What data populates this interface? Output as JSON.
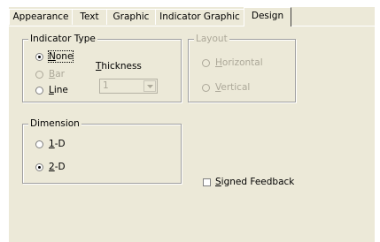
{
  "tabs": [
    {
      "label": "Appearance"
    },
    {
      "label": "Text"
    },
    {
      "label": "Graphic"
    },
    {
      "label": "Indicator Graphic"
    },
    {
      "label": "Design"
    }
  ],
  "active_tab": "Design",
  "indicator_type": {
    "title": "Indicator Type",
    "options": [
      {
        "label": "None",
        "mnemonic": "N",
        "rest": "one",
        "checked": true,
        "disabled": false
      },
      {
        "label": "Bar",
        "mnemonic": "B",
        "rest": "ar",
        "checked": false,
        "disabled": true
      },
      {
        "label": "Line",
        "mnemonic": "L",
        "rest": "ine",
        "checked": false,
        "disabled": false
      }
    ],
    "thickness": {
      "label_pre": "",
      "label_mnemonic": "T",
      "label_rest": "hickness",
      "value": "1"
    }
  },
  "layout": {
    "title": "Layout",
    "options": [
      {
        "label": "Horizontal",
        "mnemonic": "H",
        "rest": "orizontal",
        "checked": false,
        "disabled": true
      },
      {
        "label": "Vertical",
        "mnemonic": "V",
        "rest": "ertical",
        "checked": false,
        "disabled": true
      }
    ]
  },
  "dimension": {
    "title": "Dimension",
    "options": [
      {
        "label": "1-D",
        "mnemonic": "1",
        "rest": "-D",
        "checked": false,
        "disabled": false
      },
      {
        "label": "2-D",
        "mnemonic": "2",
        "rest": "-D",
        "checked": true,
        "disabled": false
      }
    ]
  },
  "signed_feedback": {
    "mnemonic": "S",
    "rest": "igned Feedback",
    "checked": false
  },
  "colors": {
    "dialog_bg": "#ece9d8",
    "disabled_text": "#aca899",
    "group_border": "#a0a0a0"
  }
}
